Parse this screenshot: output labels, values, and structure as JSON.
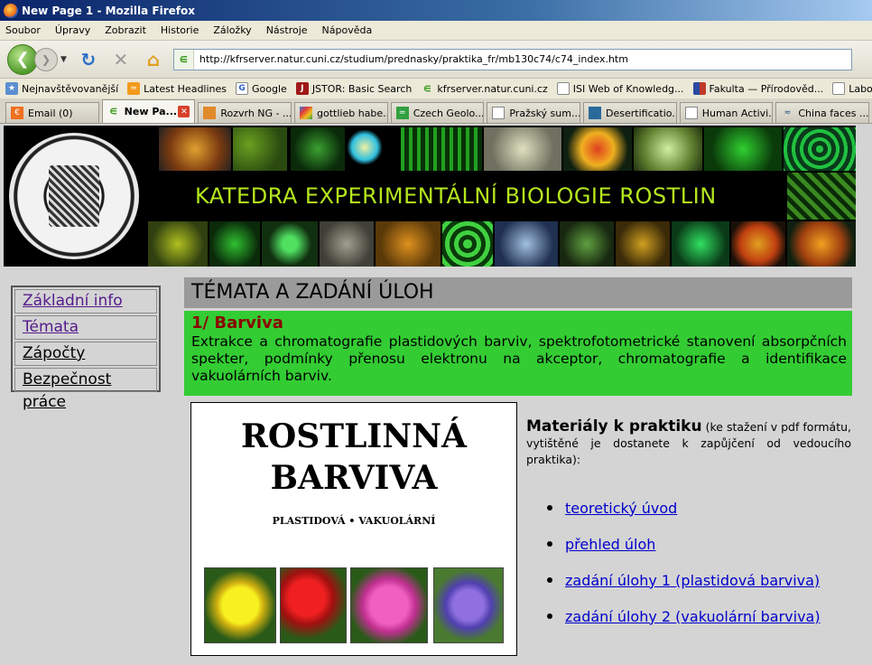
{
  "window": {
    "title": "New Page 1 - Mozilla Firefox"
  },
  "menu": [
    "Soubor",
    "Úpravy",
    "Zobrazit",
    "Historie",
    "Záložky",
    "Nástroje",
    "Nápověda"
  ],
  "url": "http://kfrserver.natur.cuni.cz/studium/prednasky/praktika_fr/mb130c74/c74_index.htm",
  "bookmarks": [
    "Nejnavštěvovanější",
    "Latest Headlines",
    "Google",
    "JSTOR: Basic Search",
    "kfrserver.natur.cuni.cz",
    "ISI Web of Knowledg...",
    "Fakulta — Přírodověd...",
    "Laboratoř elektron"
  ],
  "tabs": [
    "Email (0)",
    "New Pa...",
    "Rozvrh NG - ...",
    "gottlieb habe...",
    "Czech Geolo...",
    "Pražský sum...",
    "Desertificatio...",
    "Human Activi...",
    "China faces ..."
  ],
  "banner": {
    "title": "KATEDRA EXPERIMENTÁLNÍ BIOLOGIE ROSTLIN"
  },
  "sidebar": {
    "items": [
      "Základní info",
      "Témata",
      "Zápočty",
      "Bezpečnost práce"
    ]
  },
  "main": {
    "heading": "TÉMATA A ZADÁNÍ ÚLOH",
    "topic_title": "1/ Barviva",
    "topic_text": "Extrakce a chromatografie plastidových barviv, spektrofotometrické stanovení absorpčních spekter, podmínky přenosu elektronu na akceptor, chromatografie a identifikace vakuolárních barviv.",
    "cover": {
      "line1": "ROSTLINNÁ",
      "line2": "BARVIVA",
      "subtitle": "PLASTIDOVÁ • VAKUOLÁRNÍ"
    },
    "materials_heading": "Materiály k praktiku",
    "materials_note": " (ke stažení v pdf formátu, vytištěné je dostanete k zapůjčení od vedoucího praktika):",
    "links": [
      "teoretický úvod",
      "přehled úloh",
      "zadání úlohy 1 (plastidová barviva)",
      "zadání úlohy 2 (vakuolární barviva)"
    ]
  }
}
